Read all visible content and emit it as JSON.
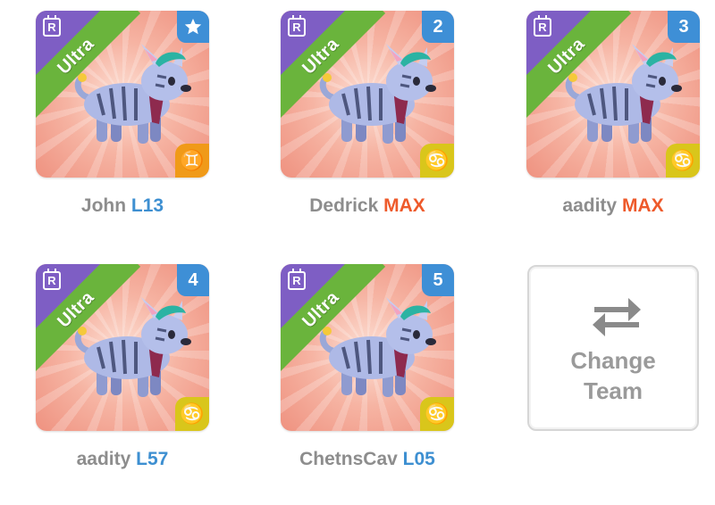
{
  "colors": {
    "rarity_ribbon": "#6ab43c",
    "rarity_corner": "#7e5ec4",
    "slot_badge": "#3e8fd6",
    "level_blue": "#3d8fd1",
    "level_max": "#ee5a2b"
  },
  "cards": [
    {
      "rarity": "Ultra",
      "rarity_icon": "R",
      "slot_badge": "star",
      "zodiac_icon": "gemini-icon",
      "zodiac_glyph": "♊",
      "name": "John",
      "level": "L13"
    },
    {
      "rarity": "Ultra",
      "rarity_icon": "R",
      "slot_badge": "2",
      "zodiac_icon": "cancer-icon",
      "zodiac_glyph": "♋",
      "name": "Dedrick",
      "level": "MAX"
    },
    {
      "rarity": "Ultra",
      "rarity_icon": "R",
      "slot_badge": "3",
      "zodiac_icon": "cancer-icon",
      "zodiac_glyph": "♋",
      "name": "aadity",
      "level": "MAX"
    },
    {
      "rarity": "Ultra",
      "rarity_icon": "R",
      "slot_badge": "4",
      "zodiac_icon": "cancer-icon",
      "zodiac_glyph": "♋",
      "name": "aadity",
      "level": "L57"
    },
    {
      "rarity": "Ultra",
      "rarity_icon": "R",
      "slot_badge": "5",
      "zodiac_icon": "cancer-icon",
      "zodiac_glyph": "♋",
      "name": "ChetnsCav",
      "level": "L05"
    }
  ],
  "change_team": {
    "line1": "Change",
    "line2": "Team",
    "icon": "swap-arrows-icon"
  }
}
